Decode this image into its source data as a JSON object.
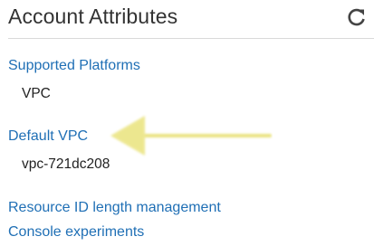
{
  "panel": {
    "title": "Account Attributes"
  },
  "attributes": {
    "supported_platforms": {
      "label": "Supported Platforms",
      "value": "VPC"
    },
    "default_vpc": {
      "label": "Default VPC",
      "value": "vpc-721dc208"
    }
  },
  "links": {
    "resource_id": "Resource ID length management",
    "console_experiments": "Console experiments"
  },
  "icons": {
    "refresh": "refresh-icon",
    "annotation": "highlight-arrow"
  },
  "colors": {
    "link": "#1f6fb5",
    "arrow": "#e9e27a"
  }
}
